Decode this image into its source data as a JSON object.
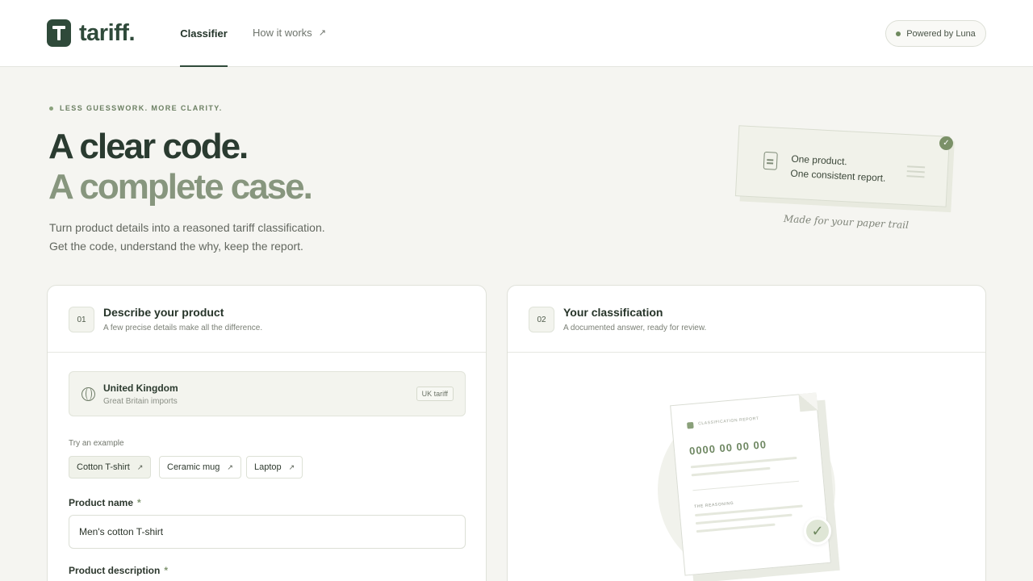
{
  "header": {
    "logo_text": "tariff.",
    "nav": {
      "classifier": "Classifier",
      "how_it_works": "How it works"
    },
    "powered_by": "Powered by Luna"
  },
  "hero": {
    "eyebrow": "LESS GUESSWORK. MORE CLARITY.",
    "headline_1": "A clear code.",
    "headline_2": "A complete case.",
    "lede_1": "Turn product details into a reasoned tariff classification.",
    "lede_2": "Get the code, understand the why, keep the report."
  },
  "paper_card": {
    "line_1": "One product.",
    "line_2": "One consistent report.",
    "caption": "Made for your paper trail"
  },
  "describe_panel": {
    "step": "01",
    "title": "Describe your product",
    "subtitle": "A few precise details make all the difference.",
    "country": {
      "name": "United Kingdom",
      "sub": "Great Britain imports",
      "badge": "UK tariff"
    },
    "examples_label": "Try an example",
    "examples": [
      "Cotton T-shirt",
      "Ceramic mug",
      "Laptop"
    ],
    "product_name_label": "Product name",
    "product_name_value": "Men's cotton T-shirt",
    "product_description_label": "Product description",
    "required_mark": "*"
  },
  "classification_panel": {
    "step": "02",
    "title": "Your classification",
    "subtitle": "A documented answer, ready for review.",
    "report": {
      "title": "CLASSIFICATION REPORT",
      "code": "0000 00 00 00",
      "reasoning_label": "THE REASONING"
    }
  },
  "colors": {
    "brand": "#2f4a3a",
    "accent": "#7b9168",
    "muted_headline": "#87967e",
    "background": "#f5f5f1"
  }
}
